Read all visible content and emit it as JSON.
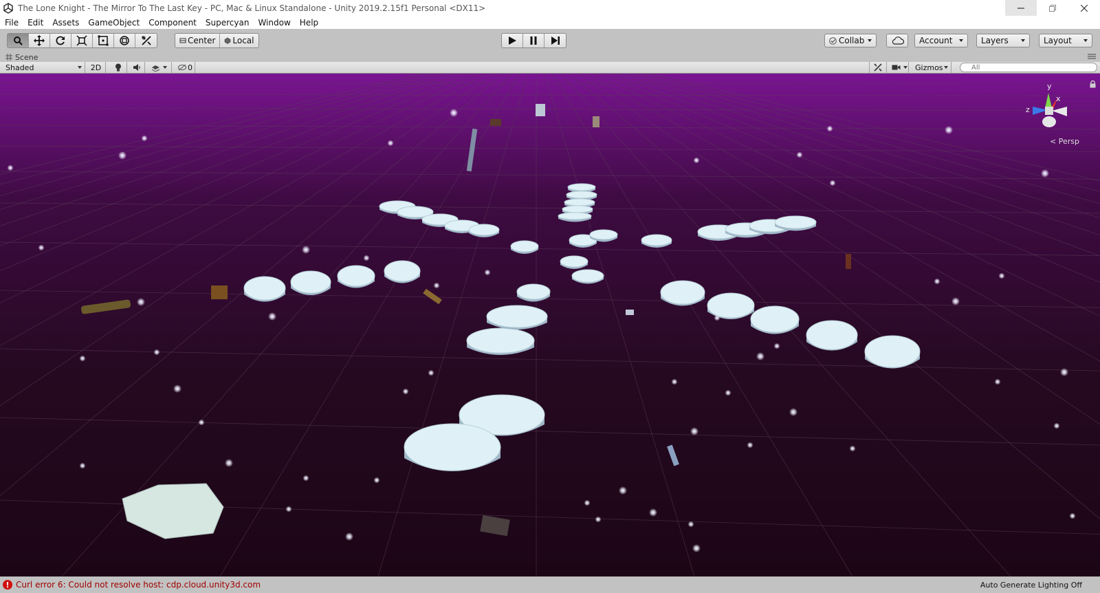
{
  "window": {
    "title": "The Lone Knight - The Mirror To The Last Key - PC, Mac & Linux Standalone - Unity 2019.2.15f1 Personal <DX11>",
    "controls": [
      "minimize-icon",
      "restore-icon",
      "close-icon"
    ]
  },
  "menu": {
    "items": [
      "File",
      "Edit",
      "Assets",
      "GameObject",
      "Component",
      "Supercyan",
      "Window",
      "Help"
    ]
  },
  "toolbar": {
    "tools": [
      "hand-icon",
      "move-icon",
      "rotate-icon",
      "scale-icon",
      "rect-icon",
      "transform-icon",
      "custom-tool-icon"
    ],
    "pivot_label": "Center",
    "space_label": "Local",
    "play_controls": [
      "play-icon",
      "pause-icon",
      "step-icon"
    ],
    "collab_label": "Collab",
    "account_label": "Account",
    "layers_label": "Layers",
    "layout_label": "Layout"
  },
  "scene": {
    "tab_label": "Scene",
    "shading_mode": "Shaded",
    "mode_2d": "2D",
    "hidden_count": "0",
    "gizmos_label": "Gizmos",
    "search_placeholder": "All",
    "projection_label": "Persp",
    "axis_labels": {
      "y": "y",
      "x": "x",
      "z": "z"
    }
  },
  "status": {
    "error_message": "Curl error 6: Could not resolve host: cdp.cloud.unity3d.com",
    "right_text": "Auto Generate Lighting Off"
  },
  "colors": {
    "sky_top": "#7a1492",
    "sky_bottom": "#1c0616",
    "platform": "#dff1f6",
    "error_red": "#d01010"
  }
}
